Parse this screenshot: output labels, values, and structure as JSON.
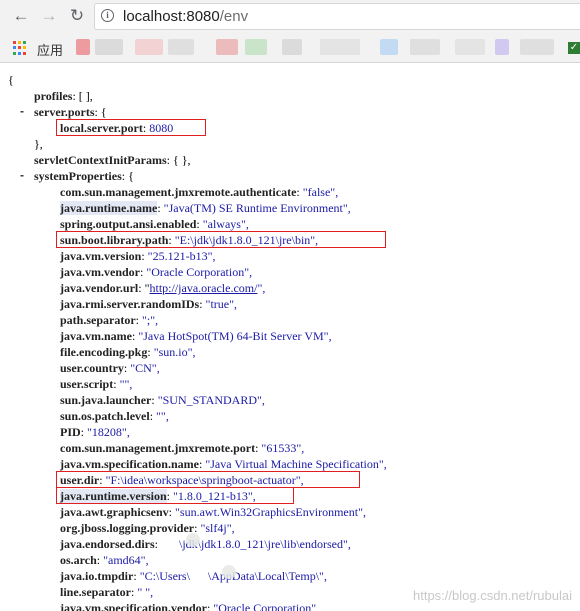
{
  "browser": {
    "url_host": "localhost:8080",
    "url_path": "/env",
    "back_icon": "arrow-left-icon",
    "forward_icon": "arrow-right-icon",
    "reload_icon": "reload-icon",
    "info_icon": "info-icon"
  },
  "bookmarks": {
    "apps_label": "应用",
    "apps_colors": [
      "#ea4335",
      "#fbbc05",
      "#34a853",
      "#4285f4",
      "#ea4335",
      "#fbbc05",
      "#34a853",
      "#4285f4",
      "#ea4335"
    ]
  },
  "json": {
    "open_brace": "{",
    "profiles_key": "profiles",
    "profiles_value": "[ ],",
    "server_ports_key": "server.ports",
    "local_server_port_key": "local.server.port",
    "local_server_port_value": "8080",
    "close_brace_comma": "},",
    "servlet_key": "servletContextInitParams",
    "servlet_value": "{ },",
    "system_props_key": "systemProperties",
    "props": [
      {
        "key": "com.sun.management.jmxremote.authenticate",
        "value": "\"false\","
      },
      {
        "key": "java.runtime.name",
        "value": "\"Java(TM) SE Runtime Environment\","
      },
      {
        "key": "spring.output.ansi.enabled",
        "value": "\"always\","
      },
      {
        "key": "sun.boot.library.path",
        "value": "\"E:\\jdk\\jdk1.8.0_121\\jre\\bin\","
      },
      {
        "key": "java.vm.version",
        "value": "\"25.121-b13\","
      },
      {
        "key": "java.vm.vendor",
        "value": "\"Oracle Corporation\","
      },
      {
        "key": "java.vendor.url",
        "value": "http://java.oracle.com/"
      },
      {
        "key": "java.rmi.server.randomIDs",
        "value": "\"true\","
      },
      {
        "key": "path.separator",
        "value": "\";\","
      },
      {
        "key": "java.vm.name",
        "value": "\"Java HotSpot(TM) 64-Bit Server VM\","
      },
      {
        "key": "file.encoding.pkg",
        "value": "\"sun.io\","
      },
      {
        "key": "user.country",
        "value": "\"CN\","
      },
      {
        "key": "user.script",
        "value": "\"\","
      },
      {
        "key": "sun.java.launcher",
        "value": "\"SUN_STANDARD\","
      },
      {
        "key": "sun.os.patch.level",
        "value": "\"\","
      },
      {
        "key": "PID",
        "value": "\"18208\","
      },
      {
        "key": "com.sun.management.jmxremote.port",
        "value": "\"61533\","
      },
      {
        "key": "java.vm.specification.name",
        "value": "\"Java Virtual Machine Specification\","
      },
      {
        "key": "user.dir",
        "value": "\"F:\\idea\\workspace\\springboot-actuator\","
      },
      {
        "key": "java.runtime.version",
        "value": "\"1.8.0_121-b13\","
      },
      {
        "key": "java.awt.graphicsenv",
        "value": "\"sun.awt.Win32GraphicsEnvironment\","
      },
      {
        "key": "org.jboss.logging.provider",
        "value": "\"slf4j\","
      },
      {
        "key": "java.endorsed.dirs",
        "value": "\\jdk\\jdk1.8.0_121\\jre\\lib\\endorsed\","
      },
      {
        "key": "os.arch",
        "value": "\"amd64\","
      },
      {
        "key": "java.io.tmpdir",
        "value": "\"C:\\Users\\",
        "value_tail": "\\AppData\\Local\\Temp\\\","
      },
      {
        "key": "line.separator",
        "value": "\" \","
      },
      {
        "key": "java.vm.specification.vendor",
        "value": "\"Oracle Corporation\","
      }
    ]
  },
  "watermark": "https://blog.csdn.net/rubulai"
}
